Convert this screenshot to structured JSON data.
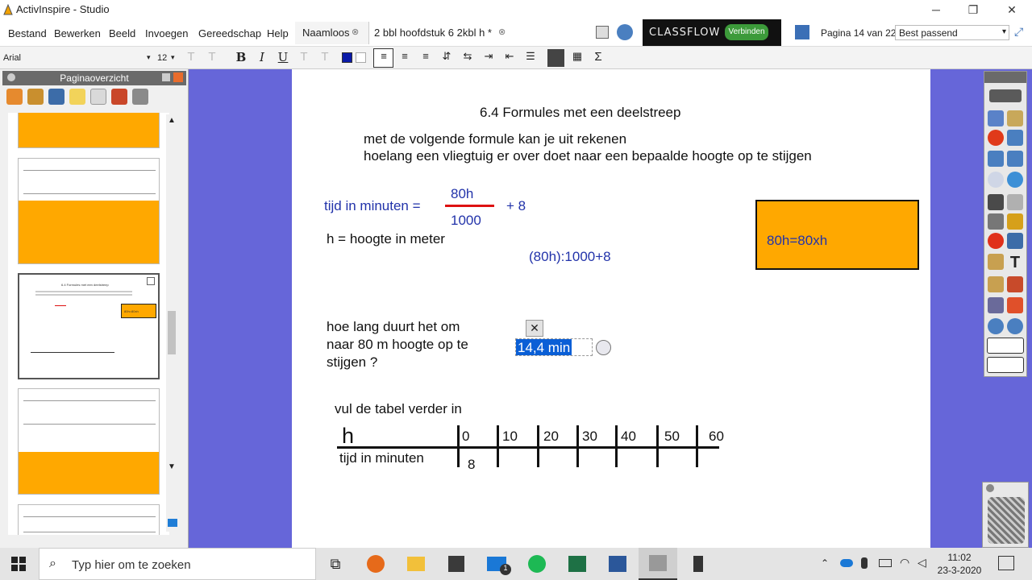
{
  "window": {
    "title": "ActivInspire - Studio",
    "minimize_icon": "─",
    "maximize_icon": "❐",
    "close_icon": "✕"
  },
  "menu": [
    "Bestand",
    "Bewerken",
    "Beeld",
    "Invoegen",
    "Gereedschap",
    "Help"
  ],
  "tabs": [
    {
      "label": "Naamloos"
    },
    {
      "label": "2 bbl hoofdstuk 6 2kbl h *"
    }
  ],
  "classflow": {
    "logo": "CLASSFLOW",
    "connect_label": "Verbinden"
  },
  "page_indicator": "Pagina 14 van 22",
  "zoom": "Best passend",
  "format": {
    "font": "Arial",
    "size": "12",
    "bold": "B",
    "italic": "I",
    "underline": "U",
    "sum": "Σ"
  },
  "left_panel": {
    "title": "Paginaoverzicht",
    "thumb_title": "6.4 Formules met een deelstreep",
    "thumb_answer": "80h=80xh"
  },
  "slide": {
    "heading": "6.4 Formules met een deelstreep",
    "intro_line1": "met de volgende formule kan je uit rekenen",
    "intro_line2": "hoelang een vliegtuig er over doet naar een bepaalde hoogte op te stijgen",
    "formula_label": "tijd in minuten =",
    "numerator": "80h",
    "denominator": "1000",
    "plus": "+ 8",
    "h_def": "h = hoogte in meter",
    "calc": "(80h):1000+8",
    "box_text": "80h=80xh",
    "question_line1": "hoe lang duurt het om",
    "question_line2": "naar 80 m hoogte op te",
    "question_line3": "stijgen ?",
    "answer": "14,4 min",
    "close_glyph": "✕",
    "table_instruction": "vul de tabel verder in",
    "table": {
      "row1_label": "h",
      "row2_label": "tijd in minuten",
      "columns": [
        "0",
        "10",
        "20",
        "30",
        "40",
        "50",
        "60"
      ],
      "row2_values": [
        "8",
        "",
        "",
        "",
        "",
        "",
        ""
      ]
    },
    "colors": {
      "accent_blue": "#2233aa",
      "red": "#dd1111",
      "orange": "#ffa800"
    }
  },
  "taskbar": {
    "search_placeholder": "Typ hier om te zoeken",
    "time": "11:02",
    "date": "23-3-2020",
    "mail_badge": "1"
  }
}
